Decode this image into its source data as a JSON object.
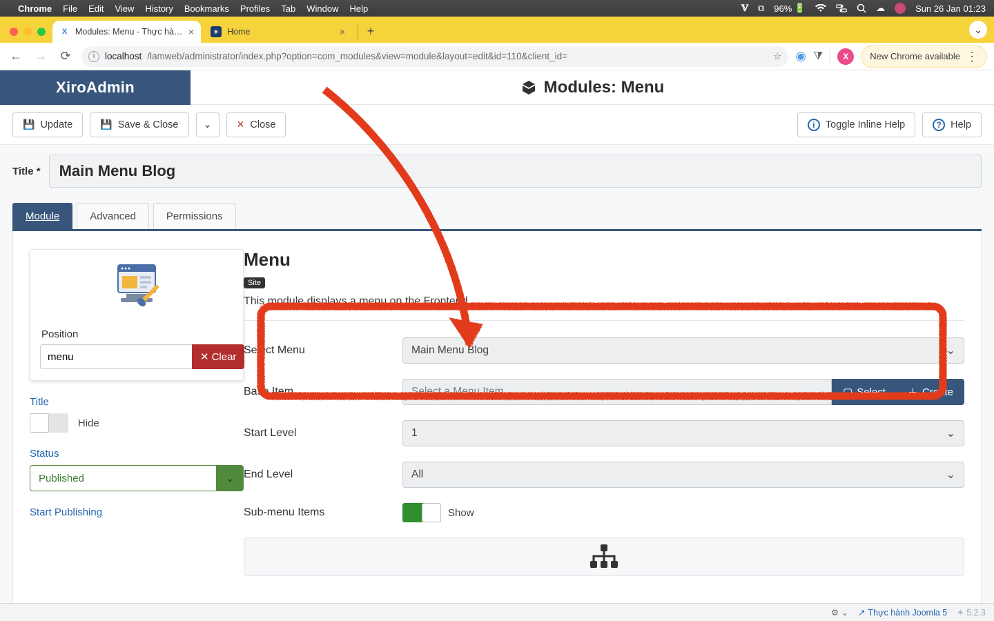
{
  "mac": {
    "app": "Chrome",
    "menus": [
      "File",
      "Edit",
      "View",
      "History",
      "Bookmarks",
      "Profiles",
      "Tab",
      "Window",
      "Help"
    ],
    "battery": "96%",
    "clock": "Sun 26 Jan  01:23"
  },
  "chrome": {
    "tabs": [
      {
        "title": "Modules: Menu - Thực hành J",
        "active": true
      },
      {
        "title": "Home",
        "active": false
      }
    ],
    "url_host": "localhost",
    "url_path": "/lamweb/administrator/index.php?option=com_modules&view=module&layout=edit&id=110&client_id=",
    "update_label": "New Chrome available"
  },
  "header": {
    "brand": "XiroAdmin",
    "page_title": "Modules: Menu"
  },
  "actions": {
    "update": "Update",
    "save_close": "Save & Close",
    "close": "Close",
    "toggle_help": "Toggle Inline Help",
    "help": "Help"
  },
  "form": {
    "title_label": "Title *",
    "title_value": "Main Menu Blog",
    "tabs": {
      "module": "Module",
      "advanced": "Advanced",
      "permissions": "Permissions"
    },
    "heading": "Menu",
    "badge": "Site",
    "description": "This module displays a menu on the Frontend.",
    "position_label": "Position",
    "position_value": "menu",
    "clear": "Clear",
    "side_title_label": "Title",
    "side_title_toggle": "Hide",
    "status_label": "Status",
    "status_value": "Published",
    "start_publishing": "Start Publishing",
    "fields": {
      "select_menu": {
        "label": "Select Menu",
        "value": "Main Menu Blog"
      },
      "base_item": {
        "label": "Base Item",
        "placeholder": "Select a Menu Item",
        "select": "Select",
        "create": "Create"
      },
      "start_level": {
        "label": "Start Level",
        "value": "1"
      },
      "end_level": {
        "label": "End Level",
        "value": "All"
      },
      "submenu": {
        "label": "Sub-menu Items",
        "value": "Show"
      }
    }
  },
  "status": {
    "site": "Thực hành Joomla 5",
    "version": "5.2.3"
  }
}
